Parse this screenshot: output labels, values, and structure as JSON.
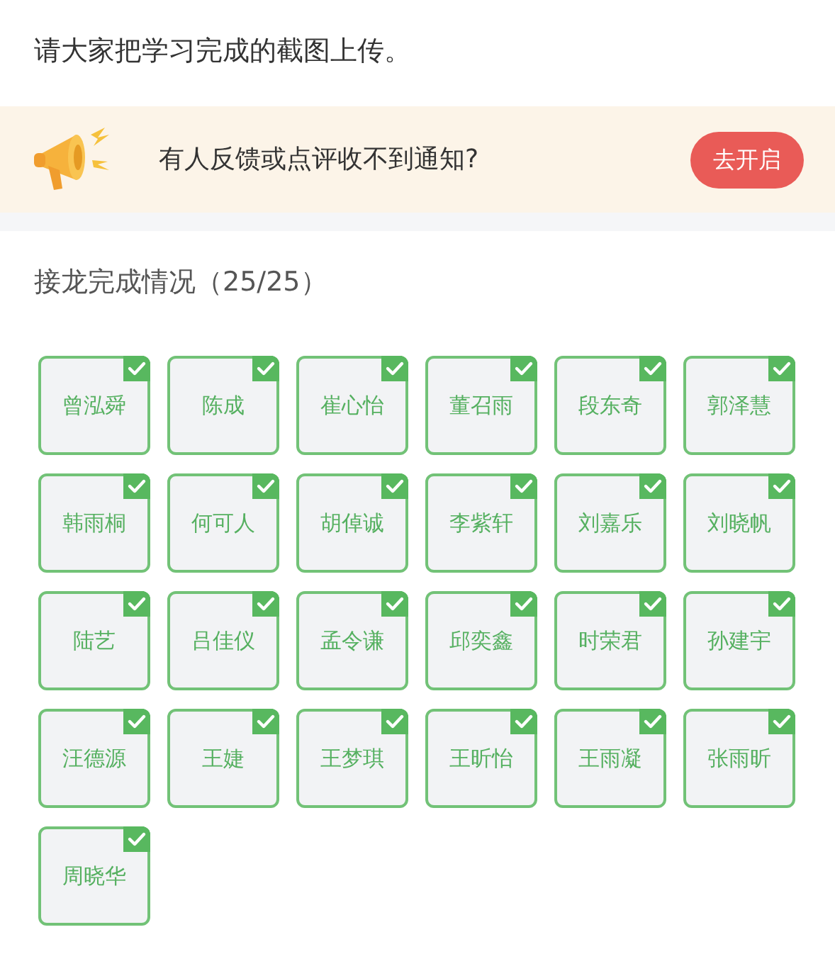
{
  "message": "请大家把学习完成的截图上传。",
  "notice": {
    "text": "有人反馈或点评收不到通知?",
    "button": "去开启"
  },
  "progress": {
    "title": "接龙完成情况（25/25）"
  },
  "members": [
    {
      "name": "曾泓舜",
      "completed": true
    },
    {
      "name": "陈成",
      "completed": true
    },
    {
      "name": "崔心怡",
      "completed": true
    },
    {
      "name": "董召雨",
      "completed": true
    },
    {
      "name": "段东奇",
      "completed": true
    },
    {
      "name": "郭泽慧",
      "completed": true
    },
    {
      "name": "韩雨桐",
      "completed": true
    },
    {
      "name": "何可人",
      "completed": true
    },
    {
      "name": "胡倬诚",
      "completed": true
    },
    {
      "name": "李紫轩",
      "completed": true
    },
    {
      "name": "刘嘉乐",
      "completed": true
    },
    {
      "name": "刘晓帆",
      "completed": true
    },
    {
      "name": "陆艺",
      "completed": true
    },
    {
      "name": "吕佳仪",
      "completed": true
    },
    {
      "name": "孟令谦",
      "completed": true
    },
    {
      "name": "邱奕鑫",
      "completed": true
    },
    {
      "name": "时荣君",
      "completed": true
    },
    {
      "name": "孙建宇",
      "completed": true
    },
    {
      "name": "汪德源",
      "completed": true
    },
    {
      "name": "王婕",
      "completed": true
    },
    {
      "name": "王梦琪",
      "completed": true
    },
    {
      "name": "王昕怡",
      "completed": true
    },
    {
      "name": "王雨凝",
      "completed": true
    },
    {
      "name": "张雨昕",
      "completed": true
    },
    {
      "name": "周晓华",
      "completed": true
    }
  ]
}
